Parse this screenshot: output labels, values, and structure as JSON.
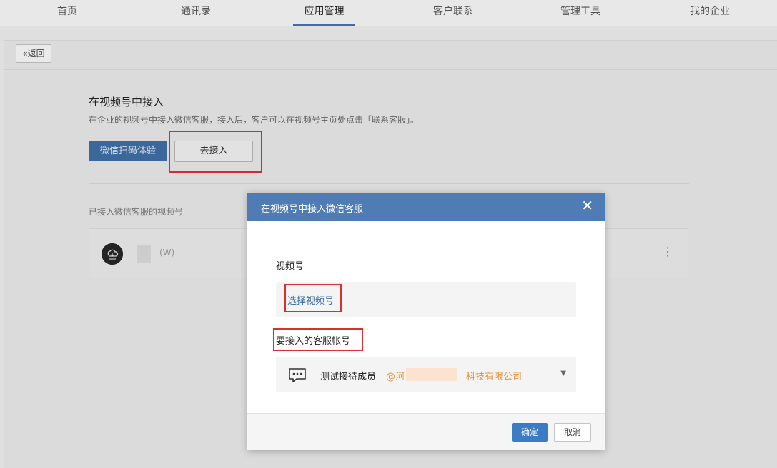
{
  "nav": {
    "items": [
      {
        "label": "首页"
      },
      {
        "label": "通讯录"
      },
      {
        "label": "应用管理"
      },
      {
        "label": "客户联系"
      },
      {
        "label": "管理工具"
      },
      {
        "label": "我的企业"
      }
    ],
    "active_index": 2
  },
  "page": {
    "back_label": "返回",
    "section_title": "在视频号中接入",
    "section_desc": "在企业的视频号中接入微信客服，接入后，客户可以在视频号主页处点击「联系客服」。",
    "scan_button": "微信扫码体验",
    "connect_button": "去接入",
    "connected_label": "已接入微信客服的视频号",
    "connected_account": {
      "avatar_text": "头像",
      "suffix": "(W)",
      "more_icon": "more-vertical-icon"
    }
  },
  "modal": {
    "title": "在视频号中接入微信客服",
    "close_icon": "close-icon",
    "channel_label": "视频号",
    "select_channel_link": "选择视频号",
    "account_label": "要接入的客服帐号",
    "account_icon": "chat-bubble-icon",
    "account_name": "测试接待成员",
    "account_org_prefix": "@河",
    "account_org_suffix": "科技有限公司",
    "dropdown_icon": "caret-down-icon",
    "ok_button": "确定",
    "cancel_button": "取消"
  },
  "colors": {
    "header_blue": "#4f7cb5",
    "primary_blue": "#3b7cc4",
    "highlight_red": "#d9302c",
    "org_orange": "#e8903a",
    "link_blue": "#3b6ea5"
  }
}
